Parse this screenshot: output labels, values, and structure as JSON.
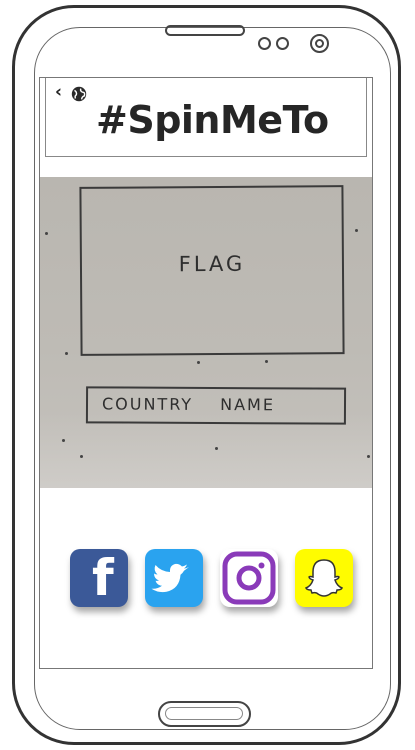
{
  "header": {
    "title": "#SpinMeTo",
    "back_icon": "back-chevron-icon",
    "globe_icon": "globe-icon"
  },
  "sketch": {
    "flag_label": "FLAG",
    "country_label": "COUNTRY NAME"
  },
  "social": [
    {
      "name": "facebook",
      "icon": "facebook-icon",
      "color": "#3b5998"
    },
    {
      "name": "twitter",
      "icon": "twitter-icon",
      "color": "#2aa3ef"
    },
    {
      "name": "instagram",
      "icon": "instagram-icon",
      "color": "#8a3ab9"
    },
    {
      "name": "snapchat",
      "icon": "snapchat-icon",
      "color": "#fffc00"
    }
  ]
}
